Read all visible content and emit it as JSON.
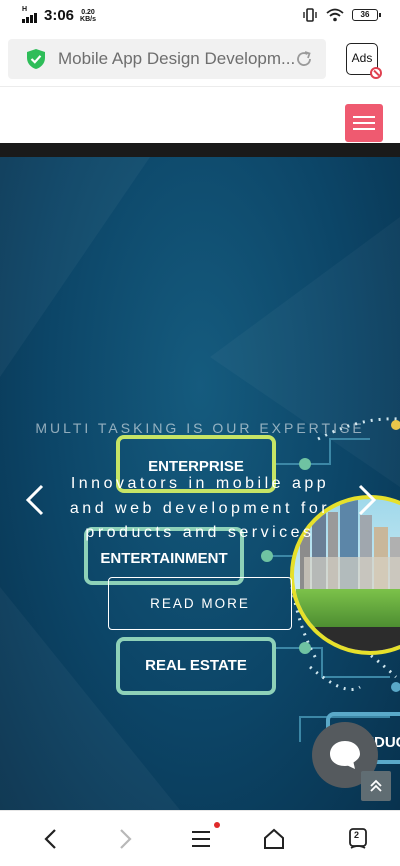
{
  "status_bar": {
    "network": "H",
    "time": "3:06",
    "speed_value": "0.20",
    "speed_unit": "KB/s",
    "battery": "36"
  },
  "browser": {
    "url_title": "Mobile App Design Developm...",
    "ads_label": "Ads",
    "secure_color": "#2ebd59"
  },
  "hero": {
    "tagline": "MULTI TASKING IS OUR EXPERTISE",
    "headline": "Innovators in mobile app and web development for products and services",
    "button_label": "READ MORE",
    "industries": [
      "ENTERPRISE",
      "ENTERTAINMENT",
      "REAL ESTATE",
      "EDUC"
    ]
  },
  "bottom_nav": {
    "tab_count": "2"
  },
  "colors": {
    "menu_button": "#ef5a70",
    "hero_bg": "#0c4567",
    "chip_border": "#8ed1b8",
    "chip_border_alt": "#c6e466",
    "globe_ring": "#e6e02b"
  }
}
